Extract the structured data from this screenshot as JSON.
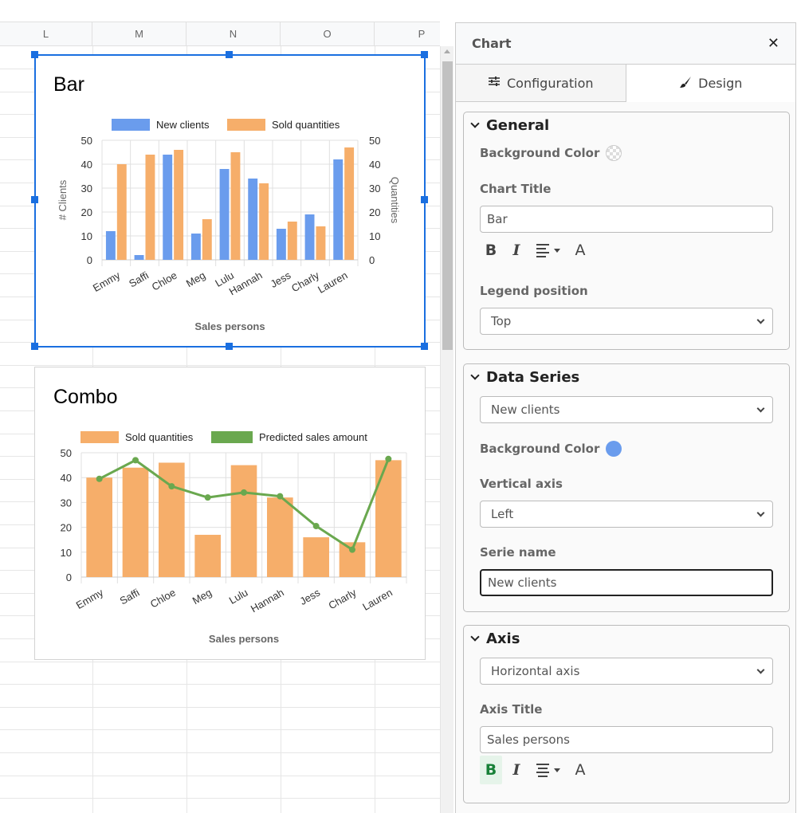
{
  "grid": {
    "columns": [
      "L",
      "M",
      "N",
      "O",
      "P"
    ]
  },
  "charts": {
    "bar": {
      "title": "Bar",
      "legend": [
        "New clients",
        "Sold quantities"
      ],
      "xlabel": "Sales persons",
      "ylabel_left": "# Clients",
      "ylabel_right": "Quantities"
    },
    "combo": {
      "title": "Combo",
      "legend": [
        "Sold quantities",
        "Predicted sales amount"
      ],
      "xlabel": "Sales persons"
    }
  },
  "chart_data": [
    {
      "type": "bar",
      "title": "Bar",
      "categories": [
        "Emmy",
        "Saffi",
        "Chloe",
        "Meg",
        "Lulu",
        "Hannah",
        "Jess",
        "Charly",
        "Lauren"
      ],
      "series": [
        {
          "name": "New clients",
          "axis": "left",
          "color": "#6a9ced",
          "values": [
            12,
            2,
            44,
            11,
            38,
            34,
            13,
            19,
            42
          ]
        },
        {
          "name": "Sold quantities",
          "axis": "right",
          "color": "#f6ae6a",
          "values": [
            40,
            44,
            46,
            17,
            45,
            32,
            16,
            14,
            47
          ]
        }
      ],
      "xlabel": "Sales persons",
      "ylabel": "# Clients",
      "ylabel_right": "Quantities",
      "ylim": [
        0,
        50
      ],
      "yticks": [
        0,
        10,
        20,
        30,
        40,
        50
      ],
      "ylim_right": [
        0,
        50
      ],
      "grid": true,
      "legend": "top"
    },
    {
      "type": "bar",
      "subtype": "combo",
      "title": "Combo",
      "categories": [
        "Emmy",
        "Saffi",
        "Chloe",
        "Meg",
        "Lulu",
        "Hannah",
        "Jess",
        "Charly",
        "Lauren"
      ],
      "series": [
        {
          "name": "Sold quantities",
          "kind": "bar",
          "color": "#f6ae6a",
          "values": [
            40,
            44,
            46,
            17,
            45,
            32,
            16,
            14,
            47
          ]
        },
        {
          "name": "Predicted sales amount",
          "kind": "line",
          "color": "#6aa84f",
          "values": [
            39.5,
            47,
            36.5,
            32,
            34,
            32.5,
            20.5,
            11,
            47.5
          ]
        }
      ],
      "xlabel": "Sales persons",
      "ylabel": "",
      "ylim": [
        0,
        50
      ],
      "yticks": [
        0,
        10,
        20,
        30,
        40,
        50
      ],
      "grid": true,
      "legend": "top"
    }
  ],
  "panel": {
    "title": "Chart",
    "close_icon": "close-icon",
    "tabs": [
      {
        "label": "Configuration",
        "icon": "sliders-icon",
        "active": false
      },
      {
        "label": "Design",
        "icon": "paintbrush-icon",
        "active": true
      }
    ],
    "general": {
      "title": "General",
      "bg_color_label": "Background Color",
      "chart_title_label": "Chart Title",
      "chart_title_value": "Bar",
      "legend_position_label": "Legend position",
      "legend_position_value": "Top"
    },
    "data_series": {
      "title": "Data Series",
      "series_value": "New clients",
      "bg_color_label": "Background Color",
      "bg_color": "#6a9ced",
      "vertical_axis_label": "Vertical axis",
      "vertical_axis_value": "Left",
      "serie_name_label": "Serie name",
      "serie_name_value": "New clients"
    },
    "axis": {
      "title": "Axis",
      "axis_value": "Horizontal axis",
      "axis_title_label": "Axis Title",
      "axis_title_value": "Sales persons"
    },
    "toolbar": {
      "bold": "B",
      "italic": "I",
      "color": "A"
    }
  }
}
